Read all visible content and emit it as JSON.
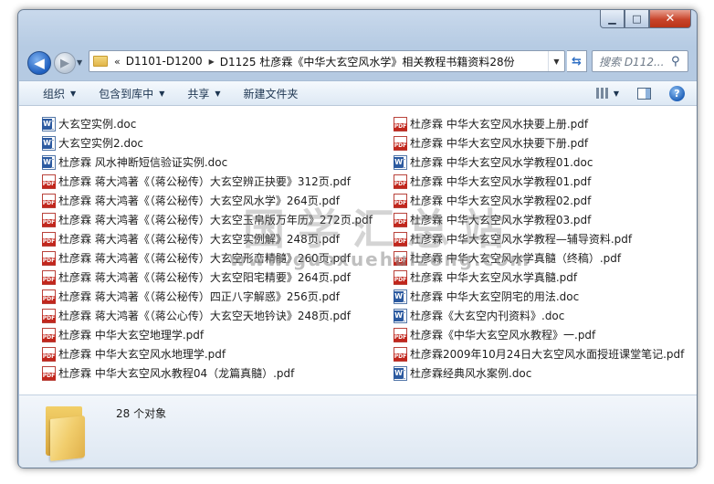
{
  "window": {
    "controls": {
      "minimize": "▁",
      "maximize": "□",
      "close": "✕"
    }
  },
  "address": {
    "chevron": "«",
    "segments": [
      "D1101-D1200",
      "D1125 杜彦霖《中华大玄空风水学》相关教程书籍资料28份"
    ],
    "separator": "▶",
    "dropdown": "▼"
  },
  "search": {
    "placeholder": "搜索 D112..."
  },
  "toolbar": {
    "organize": "组织",
    "include_in_library": "包含到库中",
    "share": "共享",
    "new_folder": "新建文件夹"
  },
  "files_left": [
    {
      "name": "大玄空实例.doc",
      "type": "doc"
    },
    {
      "name": "大玄空实例2.doc",
      "type": "doc"
    },
    {
      "name": "杜彦霖 风水神断短信验证实例.doc",
      "type": "doc"
    },
    {
      "name": "杜彦霖 蒋大鸿著《（蒋公秘传）大玄空辨正抉要》312页.pdf",
      "type": "pdf"
    },
    {
      "name": "杜彦霖 蒋大鸿著《（蒋公秘传）大玄空风水学》264页.pdf",
      "type": "pdf"
    },
    {
      "name": "杜彦霖 蒋大鸿著《（蒋公秘传）大玄空玉帛版万年历》272页.pdf",
      "type": "pdf"
    },
    {
      "name": "杜彦霖 蒋大鸿著《（蒋公秘传）大玄空实例解》248页.pdf",
      "type": "pdf"
    },
    {
      "name": "杜彦霖 蒋大鸿著《（蒋公秘传）大玄空形峦精髓》260页.pdf",
      "type": "pdf"
    },
    {
      "name": "杜彦霖 蒋大鸿著《（蒋公秘传）大玄空阳宅精要》264页.pdf",
      "type": "pdf"
    },
    {
      "name": "杜彦霖 蒋大鸿著《（蒋公秘传）四正八字解惑》256页.pdf",
      "type": "pdf"
    },
    {
      "name": "杜彦霖 蒋大鸿著《（蒋公心传）大玄空天地钤诀》248页.pdf",
      "type": "pdf"
    },
    {
      "name": "杜彦霖 中华大玄空地理学.pdf",
      "type": "pdf"
    },
    {
      "name": "杜彦霖 中华大玄空风水地理学.pdf",
      "type": "pdf"
    },
    {
      "name": "杜彦霖 中华大玄空风水教程04（龙篇真髓）.pdf",
      "type": "pdf"
    }
  ],
  "files_right": [
    {
      "name": "杜彦霖 中华大玄空风水抉要上册.pdf",
      "type": "pdf"
    },
    {
      "name": "杜彦霖 中华大玄空风水抉要下册.pdf",
      "type": "pdf"
    },
    {
      "name": "杜彦霖 中华大玄空风水学教程01.doc",
      "type": "doc"
    },
    {
      "name": "杜彦霖 中华大玄空风水学教程01.pdf",
      "type": "pdf"
    },
    {
      "name": "杜彦霖 中华大玄空风水学教程02.pdf",
      "type": "pdf"
    },
    {
      "name": "杜彦霖 中华大玄空风水学教程03.pdf",
      "type": "pdf"
    },
    {
      "name": "杜彦霖 中华大玄空风水学教程—辅导资料.pdf",
      "type": "pdf"
    },
    {
      "name": "杜彦霖 中华大玄空风水学真髓（终稿）.pdf",
      "type": "pdf"
    },
    {
      "name": "杜彦霖 中华大玄空风水学真髓.pdf",
      "type": "pdf"
    },
    {
      "name": "杜彦霖 中华大玄空阴宅的用法.doc",
      "type": "doc"
    },
    {
      "name": "杜彦霖《大玄空内刊资料》.doc",
      "type": "doc"
    },
    {
      "name": "杜彦霖《中华大玄空风水教程》一.pdf",
      "type": "pdf"
    },
    {
      "name": "杜彦霖2009年10月24日大玄空风水面授班课堂笔记.pdf",
      "type": "pdf"
    },
    {
      "name": "杜彦霖经典风水案例.doc",
      "type": "doc"
    }
  ],
  "watermark": {
    "title": "国学汇总站",
    "url": "www.guoxuehuizong.com"
  },
  "details": {
    "count": "28 个对象"
  },
  "icons": {
    "back": "arrow-left-icon",
    "forward": "arrow-right-icon",
    "refresh": "refresh-icon",
    "search": "magnifier-icon",
    "folder": "folder-icon",
    "doc": "word-doc-icon",
    "pdf": "pdf-icon",
    "help": "help-icon"
  }
}
